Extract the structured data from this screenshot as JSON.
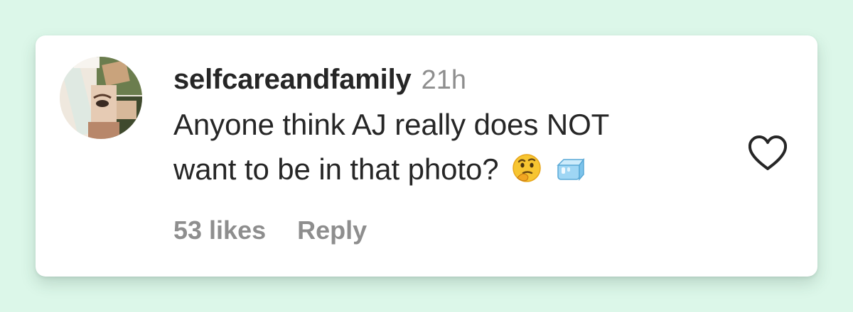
{
  "comment": {
    "username": "selfcareandfamily",
    "time": "21h",
    "text_line1": "Anyone think AJ really does NOT",
    "text_line2": "want to be in that photo?",
    "emojis": [
      "thinking-face-emoji",
      "ice-cube-emoji"
    ],
    "likes": "53 likes",
    "reply_label": "Reply"
  },
  "colors": {
    "background": "#dcf7e9",
    "card": "#ffffff",
    "text": "#262626",
    "muted": "#8e8e8e"
  }
}
